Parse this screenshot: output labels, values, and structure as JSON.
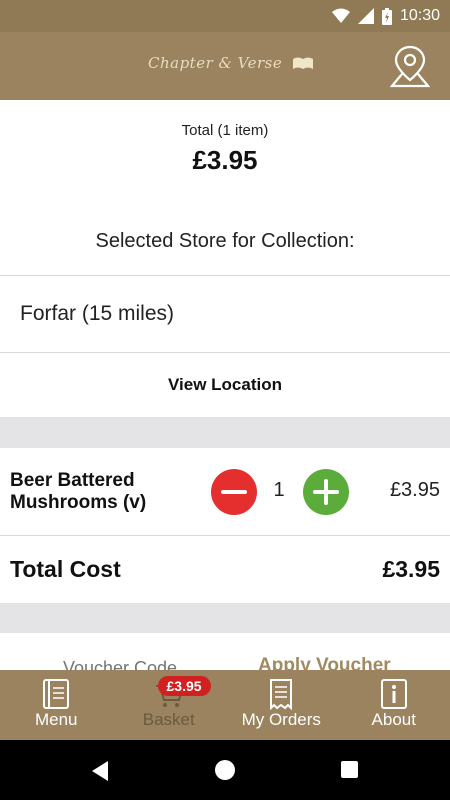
{
  "status_bar": {
    "time": "10:30",
    "icons": [
      "wifi-icon",
      "signal-icon",
      "battery-icon"
    ]
  },
  "header": {
    "logo_text": "Chapter & Verse",
    "location_icon": "map-pin-icon"
  },
  "summary": {
    "total_label": "Total (1 item)",
    "total_amount": "£3.95"
  },
  "store": {
    "heading": "Selected Store for Collection:",
    "name": "Forfar (15 miles)",
    "view_location_label": "View Location"
  },
  "basket_items": [
    {
      "name": "Beer Battered Mushrooms (v)",
      "quantity": "1",
      "price": "£3.95"
    }
  ],
  "total_cost": {
    "label": "Total Cost",
    "value": "£3.95"
  },
  "voucher": {
    "placeholder": "Voucher Code",
    "apply_label": "Apply Voucher"
  },
  "bottom_nav": {
    "items": [
      {
        "label": "Menu",
        "icon": "menu-book-icon"
      },
      {
        "label": "Basket",
        "icon": "basket-icon",
        "badge": "£3.95"
      },
      {
        "label": "My Orders",
        "icon": "receipt-icon"
      },
      {
        "label": "About",
        "icon": "info-icon"
      }
    ]
  },
  "colors": {
    "brand": "#9a835e",
    "minus": "#e52e2e",
    "plus": "#5cac3c",
    "badge": "#d0201f"
  }
}
